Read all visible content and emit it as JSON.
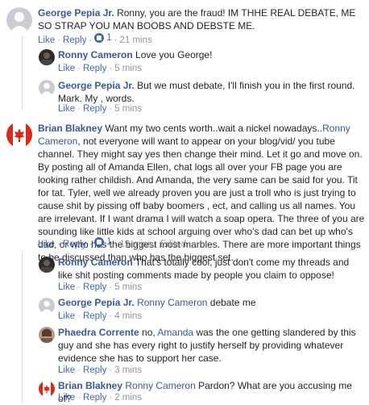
{
  "comments": [
    {
      "author": "George Pepia Jr.",
      "text": "Ronny, you are the fraud! IM THHE REAL DEBATE, ME SO STRAP YOU MAN BOOBS AND DEBSTE ME.",
      "like": "Like",
      "reply": "Reply",
      "like_count": "1",
      "time": "21 mins",
      "avatar_icon": "default-profile-icon"
    },
    {
      "author": "Ronny Cameron",
      "text": "Love you George!",
      "like": "Like",
      "reply": "Reply",
      "time": "5 mins",
      "avatar_icon": "dark-profile-photo"
    },
    {
      "author": "George Pepia Jr.",
      "text": "But we must debate, I'll finish you in the first round. Mark. My , words.",
      "like": "Like",
      "reply": "Reply",
      "time": "5 mins",
      "avatar_icon": "default-profile-icon"
    },
    {
      "author": "Brian Blakney",
      "text_before": "Want my two cents worth..wait a nickel nowadays..",
      "mention": "Ronny Cameron",
      "text_after": ", not everyone will want to appear on your blog/vid/ you tube channel. They might say yes then change their mind. Let it go and move on. By posting all of Amanda Ellen, chat logs all over your FB page you are looking rather childish. And Amanda, the very same can be said for you. Tit for tat. Tyler, well we already proven you are just a troll who is just trying to cause shit by pissing off baby boomers , ect, and calling us all names. You are irrelevant. If I want drama I will watch a soap opera. The three of you are sounding like little kids at school arguing over who's dad can bet up who's dad, or who has the biggest most marbles. There are more important things to be discussed than who has the biggest set.",
      "like": "Like",
      "reply": "Reply",
      "like_count": "1",
      "time": "19 mins",
      "edited": "Edited",
      "avatar_icon": "canada-flag-avatar"
    },
    {
      "author": "Ronny Cameron",
      "text": "That's totally cool, just don't come my threads and like shit posting comments made by people you claim to oppose!",
      "like": "Like",
      "reply": "Reply",
      "time": "5 mins",
      "avatar_icon": "dark-profile-photo"
    },
    {
      "author": "George Pepia Jr.",
      "mention": "Ronny Cameron",
      "text": "debate me",
      "like": "Like",
      "reply": "Reply",
      "time": "4 mins",
      "avatar_icon": "default-profile-icon"
    },
    {
      "author": "Phaedra Corrente",
      "text_before": "no,",
      "mention": "Amanda",
      "text_after": "was the one getting slandered by this guy and she has every right to justify herself by providing whatever evidence she has to support her case.",
      "like": "Like",
      "reply": "Reply",
      "time": "3 mins",
      "avatar_icon": "profile-photo"
    },
    {
      "author": "Brian Blakney",
      "mention": "Ronny Cameron",
      "text": "Pardon? What are you accusing me of?",
      "like": "Like",
      "reply": "Reply",
      "time": "2 mins",
      "avatar_icon": "canada-flag-avatar"
    }
  ],
  "colors": {
    "link": "#385898",
    "meta": "#90949c",
    "like_blue": "#4267b2",
    "text": "#1d2129"
  }
}
